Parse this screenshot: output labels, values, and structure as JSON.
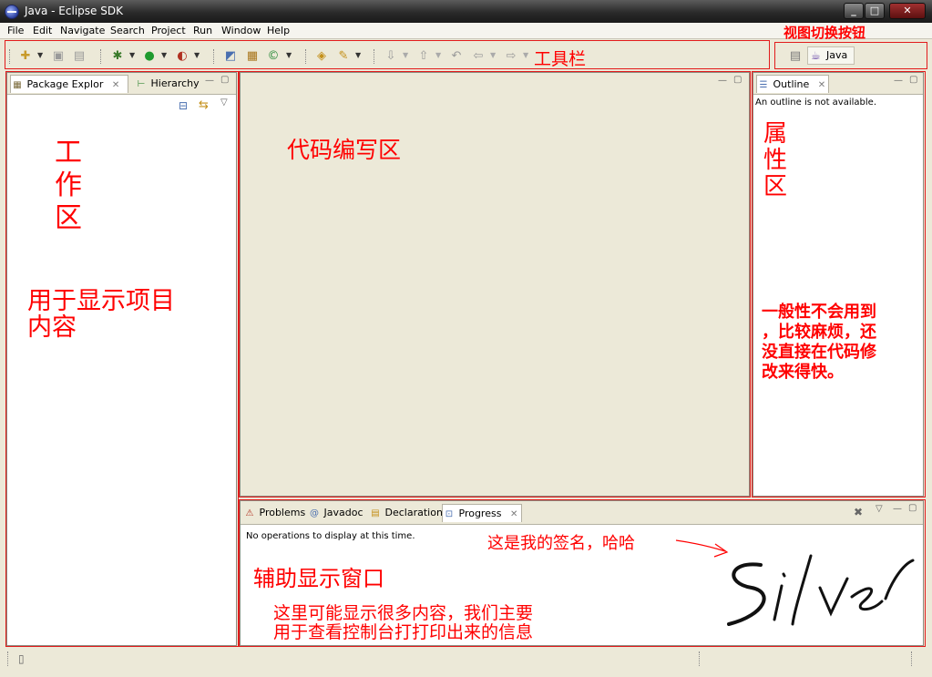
{
  "window": {
    "title": "Java - Eclipse SDK",
    "minimize": "_",
    "maximize": "□",
    "close": "✕"
  },
  "menu": [
    "File",
    "Edit",
    "Navigate",
    "Search",
    "Project",
    "Run",
    "Window",
    "Help"
  ],
  "toolbar": {
    "icons": [
      "new-wizard-icon",
      "save-icon",
      "print-icon",
      "debug-icon",
      "run-icon",
      "external-tools-icon",
      "new-java-project-icon",
      "new-package-icon",
      "new-class-icon",
      "open-type-icon",
      "search-icon",
      "next-annotation-icon",
      "prev-annotation-icon",
      "last-edit-location-icon",
      "back-icon",
      "forward-icon"
    ]
  },
  "perspective": {
    "label": "Java"
  },
  "annotations": {
    "toolbar": "工具栏",
    "perspective_switch": "视图切换按钮",
    "workspace_title": "工\n作\n区",
    "workspace_desc": "用于显示项目\n内容",
    "editor_area": "代码编写区",
    "properties_title": "属\n性\n区",
    "properties_desc": "一般性不会用到\n，比较麻烦，还\n没直接在代码修\n改来得快。",
    "aux_window": "辅助显示窗口",
    "aux_desc": "这里可能显示很多内容，我们主要\n用于查看控制台打打印出来的信息",
    "signature_note": "这是我的签名，哈哈",
    "signature": "Silver"
  },
  "left_panel": {
    "tabs": [
      {
        "label": "Package Explor",
        "close": "✕"
      },
      {
        "label": "Hierarchy"
      }
    ]
  },
  "outline_panel": {
    "tab": {
      "label": "Outline",
      "close": "✕"
    },
    "message": "An outline is not available."
  },
  "bottom_panel": {
    "tabs": [
      {
        "label": "Problems"
      },
      {
        "label": "Javadoc"
      },
      {
        "label": "Declaration"
      },
      {
        "label": "Progress",
        "close": "✕"
      }
    ],
    "message": "No operations to display at this time."
  },
  "colors": {
    "annotation": "#ff0000",
    "titlebar": "#2a2a2a",
    "chrome": "#ece9d8"
  }
}
